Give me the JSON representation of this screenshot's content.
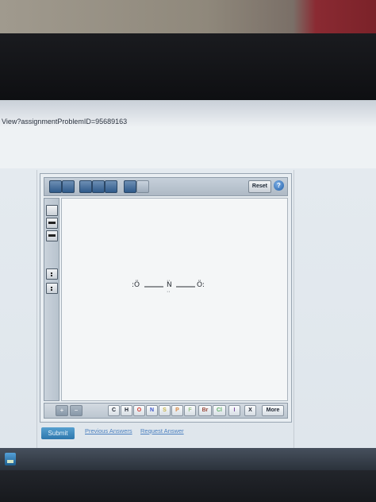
{
  "browser": {
    "url_text": "View?assignmentProblemID=95689163"
  },
  "editor": {
    "toolbar": {
      "buttons": [
        "select-tool",
        "eraser-tool",
        "atom-tool",
        "bond-tool",
        "ring-tool",
        "undo-tool",
        "zoom-tool"
      ],
      "reset_label": "Reset",
      "help_label": "?"
    },
    "side_tools": [
      "single-bond",
      "double-bond",
      "triple-bond",
      "lone-pair",
      "radical"
    ],
    "molecule": {
      "atom1": ":Ö",
      "atom2": "N",
      "atom3": "Ö:"
    },
    "bottom": {
      "plus_label": "+",
      "minus_label": "−",
      "elements": [
        "C",
        "H",
        "O",
        "N",
        "S",
        "P",
        "F",
        "Br",
        "Cl",
        "I",
        "X"
      ],
      "element_colors": {
        "C": "#1d2430",
        "H": "#1d2430",
        "O": "#d33a2f",
        "N": "#3c55c9",
        "S": "#c8b44a",
        "P": "#d7863f",
        "F": "#9ac48b",
        "Br": "#9a4a3c",
        "Cl": "#5fae67",
        "I": "#7a4aa0",
        "X": "#1d2430"
      },
      "more_label": "More"
    }
  },
  "actions": {
    "submit_label": "Submit",
    "previous_answers_label": "Previous Answers",
    "request_answer_label": "Request Answer"
  }
}
